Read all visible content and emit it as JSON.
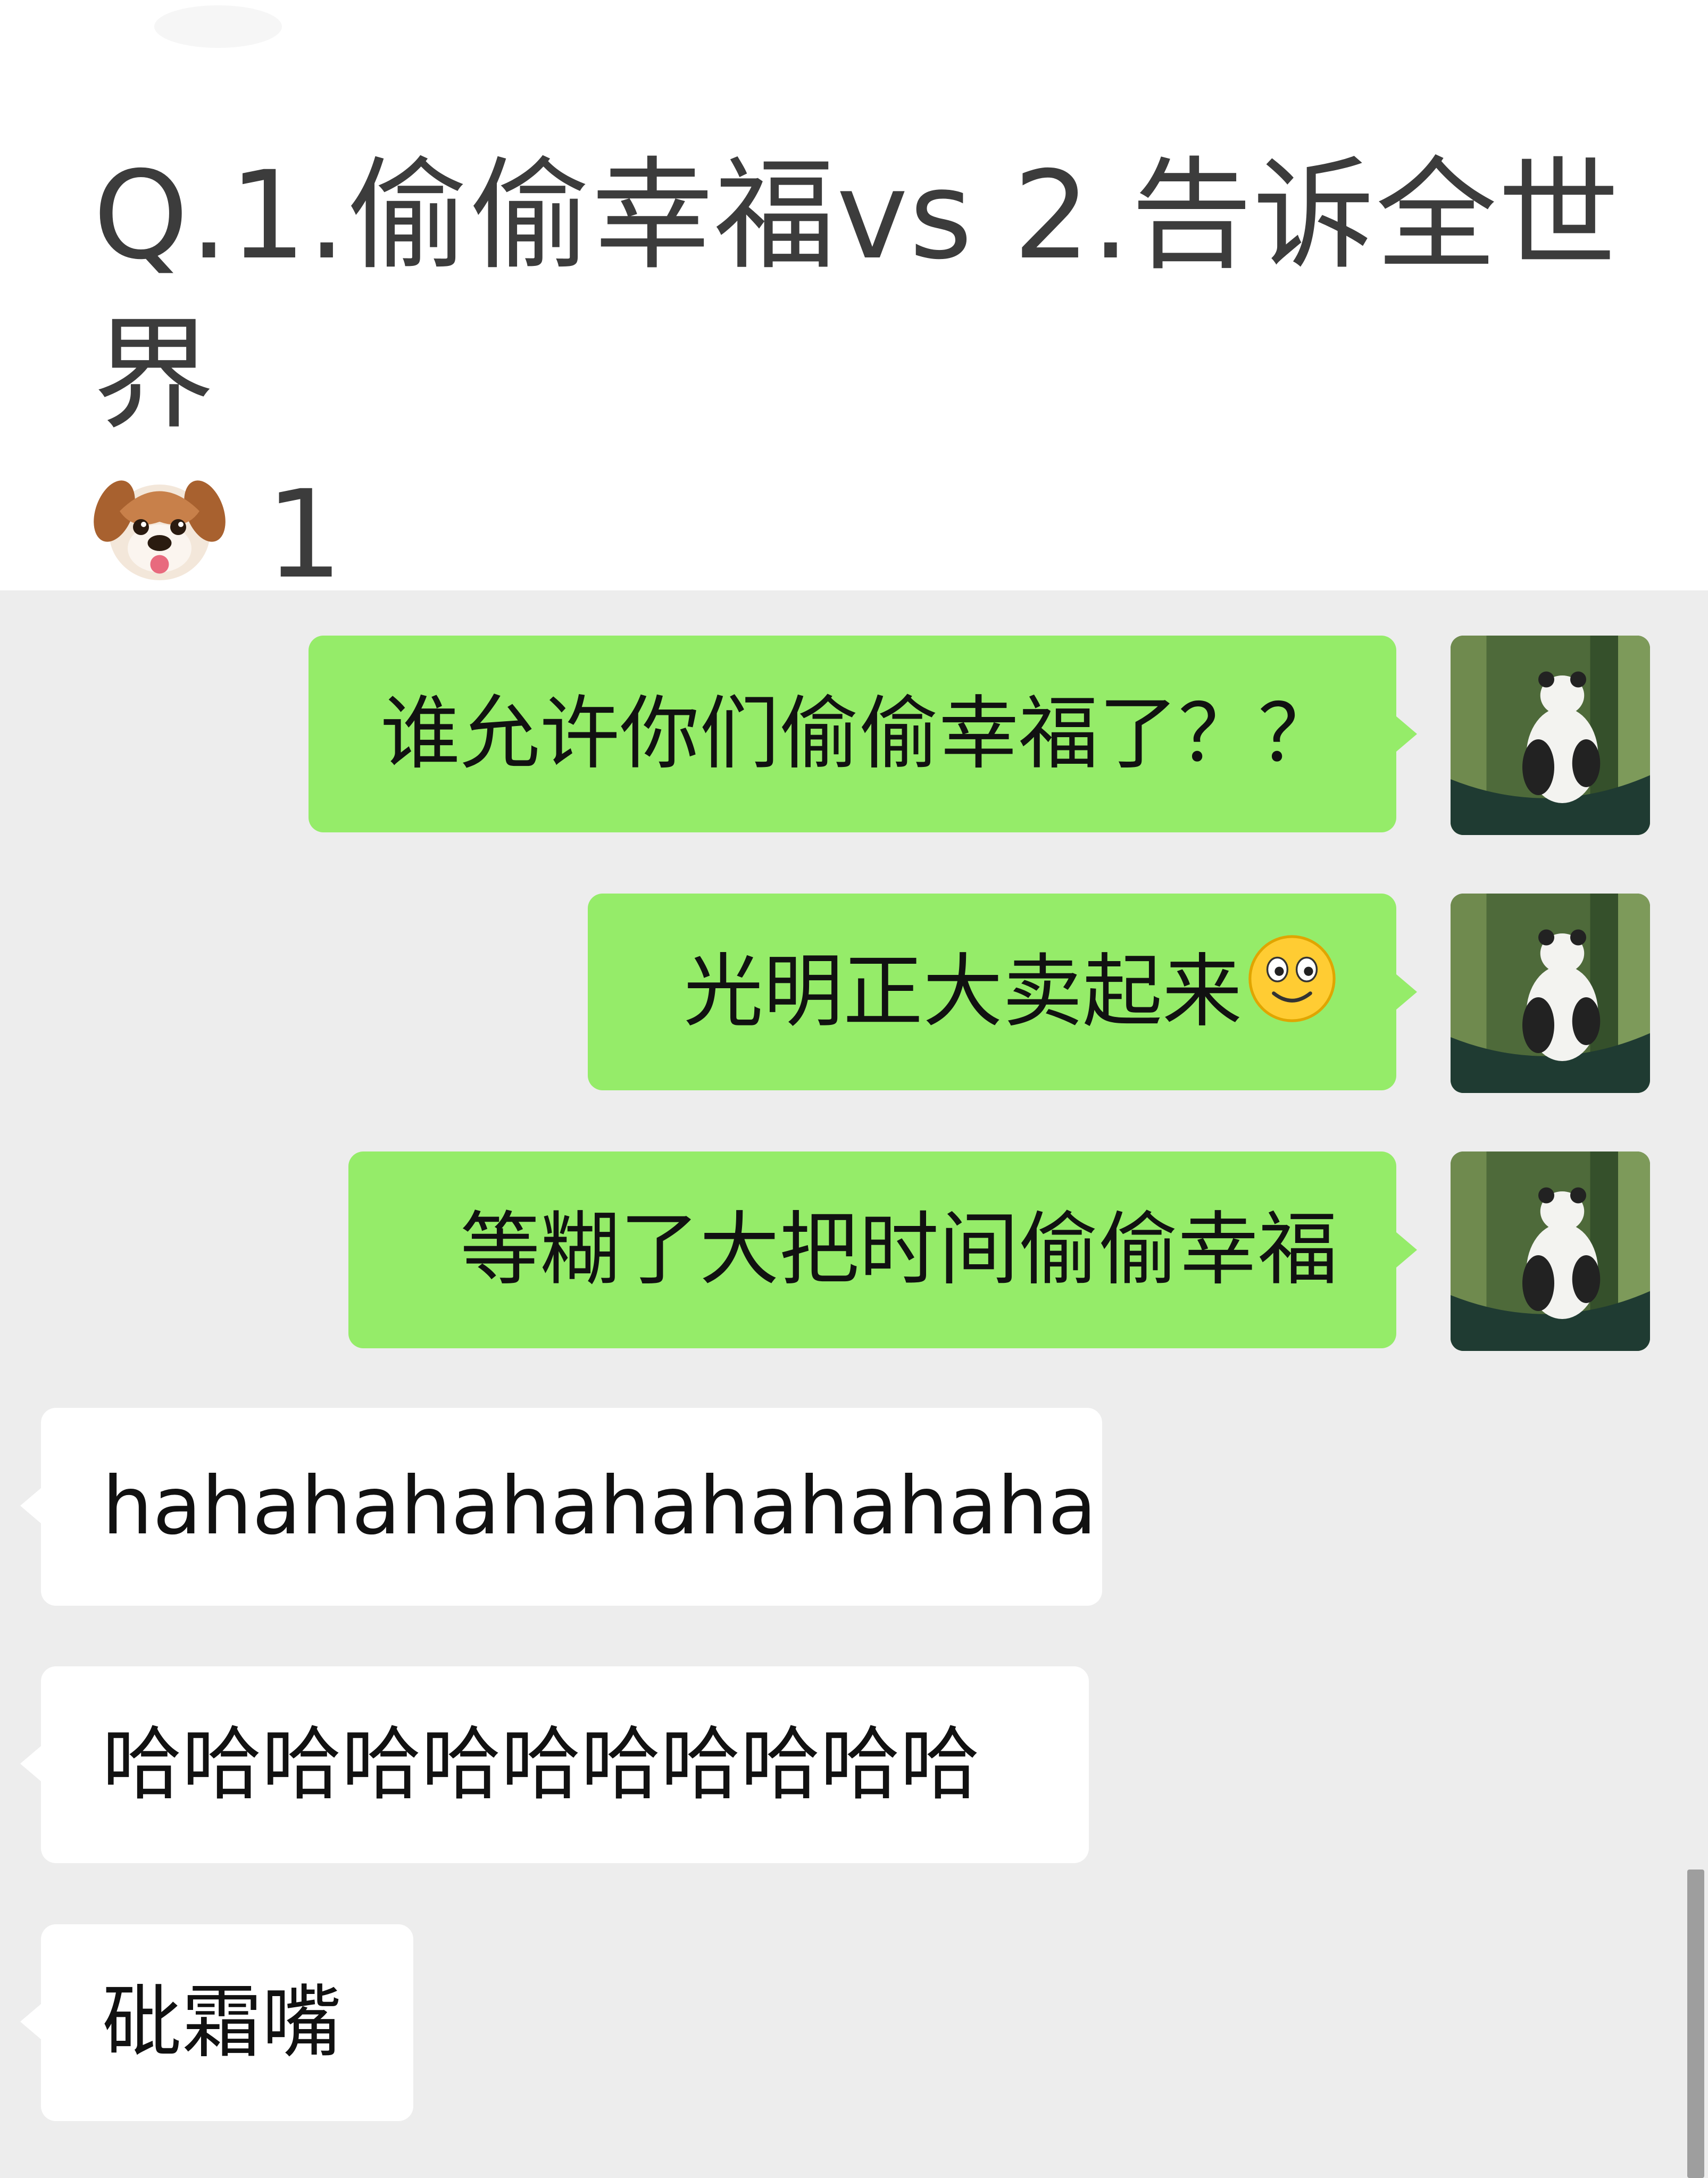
{
  "post": {
    "title_line1": "Q.1.偷偷幸福vs 2.告诉全世界",
    "title_line2": " 1",
    "title_emoji": "dog-face-icon"
  },
  "messages": [
    {
      "side": "sent",
      "text": "谁允许你们偷偷幸福了？？",
      "avatar": "panda-avatar"
    },
    {
      "side": "sent",
      "text": "光明正大卖起来",
      "emoji": "smiling-face-icon",
      "avatar": "panda-avatar"
    },
    {
      "side": "sent",
      "text": "等糊了大把时间偷偷幸福",
      "avatar": "panda-avatar"
    },
    {
      "side": "recv",
      "text": "hahahahahahahahahaha"
    },
    {
      "side": "recv",
      "text": "哈哈哈哈哈哈哈哈哈哈哈"
    },
    {
      "side": "recv",
      "text": "砒霜嘴"
    }
  ],
  "colors": {
    "sent_bubble": "#95ec69",
    "recv_bubble": "#ffffff",
    "chat_bg": "#ededed",
    "title_text": "#3c3c3c"
  }
}
